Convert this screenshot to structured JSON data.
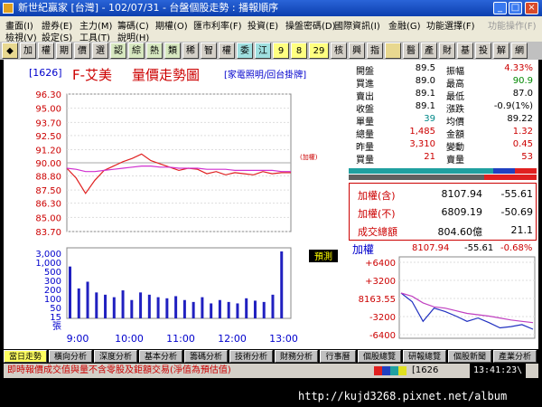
{
  "window": {
    "title": "新世紀贏家 [台灣] - 102/07/31 - 台盤個股走勢 : 播報順序",
    "minimize": "_",
    "maximize": "□",
    "close": "×"
  },
  "menu": {
    "row1": [
      "畫面(I)",
      "證券(E)",
      "主力(M)",
      "籌碼(C)",
      "期權(O)",
      "匯市利率(F)",
      "投資(E)",
      "操盤密碼(D)",
      "國際資訊(I)",
      "金融(G)",
      "功能選擇(F)",
      "功能操作(F)"
    ],
    "row2": [
      "檢視(V)",
      "設定(S)",
      "工具(T)",
      "說明(H)"
    ]
  },
  "toolbar": [
    "◆",
    "加",
    "權",
    "期",
    "價",
    "選",
    "認",
    "綜",
    "熱",
    "類",
    "稀",
    "智",
    "權",
    "委",
    "江",
    "9",
    "8",
    "29",
    "核",
    "興",
    "指",
    "",
    "醫",
    "產",
    "財",
    "基",
    "投",
    "解",
    "網"
  ],
  "stock": {
    "code": "[1626]",
    "name": "F-艾美",
    "chart_title": "量價走勢圖",
    "links": "[家電照明/回台掛牌]",
    "price_marker": "(加權)",
    "volume_button": "預測"
  },
  "quote": {
    "rows": [
      {
        "l1": "開盤",
        "v1": "89.5",
        "c1": "#000000",
        "l2": "振幅",
        "v2": "4.33%",
        "c2": "#cc0000"
      },
      {
        "l1": "買進",
        "v1": "89.0",
        "c1": "#000000",
        "l2": "最高",
        "v2": "90.9",
        "c2": "#008800"
      },
      {
        "l1": "賣出",
        "v1": "89.1",
        "c1": "#000000",
        "l2": "最低",
        "v2": "87.0",
        "c2": "#000000"
      },
      {
        "l1": "收盤",
        "v1": "89.1",
        "c1": "#000000",
        "l2": "漲跌",
        "v2": "-0.9(1%)",
        "c2": "#000000"
      },
      {
        "l1": "單量",
        "v1": "39",
        "c1": "#008888",
        "l2": "均價",
        "v2": "89.22",
        "c2": "#000000"
      },
      {
        "l1": "總量",
        "v1": "1,485",
        "c1": "#cc0000",
        "l2": "金額",
        "v2": "1.32",
        "c2": "#cc0000"
      },
      {
        "l1": "昨量",
        "v1": "3,310",
        "c1": "#cc0000",
        "l2": "變動",
        "v2": "0.45",
        "c2": "#cc0000"
      },
      {
        "l1": "買量",
        "v1": "21",
        "c1": "#cc0000",
        "l2": "賣量",
        "v2": "53",
        "c2": "#cc0000"
      }
    ]
  },
  "index": {
    "rows": [
      {
        "label": "加權(含)",
        "value": "8107.94",
        "change": "-55.61"
      },
      {
        "label": "加權(不)",
        "value": "6809.19",
        "change": "-50.69"
      },
      {
        "label": "成交總額",
        "value": "804.60億",
        "change": "21.1"
      }
    ],
    "mini_label": "加權",
    "mini_value": "8107.94",
    "mini_change": "-55.61",
    "mini_pct": "-0.68%",
    "mini_yticks": [
      "+6400",
      "+3200",
      "8163.55",
      "-3200",
      "-6400"
    ]
  },
  "tabs": [
    "當日走勢",
    "橫向分析",
    "深度分析",
    "基本分析",
    "籌碼分析",
    "技術分析",
    "財務分析",
    "行事曆",
    "個股總覽",
    "研報總覽",
    "個股新聞",
    "產業分析"
  ],
  "status": {
    "text": "即時報價成交值與量不含零股及鉅額交易(淨值為預估值)",
    "code": "[1626",
    "time": "13:41:23\\"
  },
  "watermark": "http://kujd3268.pixnet.net/album",
  "colors": {
    "price": "#e02020",
    "avg": "#d030d0",
    "volume": "#2020c0",
    "mini_index": "#2030c0",
    "mini_ref": "#c040c0"
  },
  "chart_data": [
    {
      "type": "line",
      "name": "price",
      "yticks": [
        "96.30",
        "95.00",
        "93.70",
        "92.50",
        "91.20",
        "90.00",
        "88.80",
        "87.50",
        "86.30",
        "85.00",
        "83.70"
      ],
      "ylim": [
        83.7,
        96.3
      ],
      "xticks": [
        "9:00",
        "10:00",
        "11:00",
        "12:00",
        "13:00"
      ],
      "x": [
        "9:00",
        "9:05",
        "9:10",
        "9:15",
        "9:20",
        "9:30",
        "9:40",
        "9:50",
        "10:00",
        "10:10",
        "10:20",
        "10:30",
        "10:40",
        "10:50",
        "11:00",
        "11:15",
        "11:30",
        "11:45",
        "12:00",
        "12:15",
        "12:30",
        "12:45",
        "13:00",
        "13:15",
        "13:30"
      ],
      "series": [
        {
          "values": [
            89.5,
            88.6,
            87.2,
            88.4,
            89.3,
            89.7,
            90.1,
            90.4,
            90.8,
            90.2,
            89.9,
            89.6,
            89.3,
            89.5,
            89.4,
            89.0,
            89.2,
            88.9,
            89.1,
            89.0,
            88.9,
            89.2,
            89.0,
            89.1,
            89.1
          ]
        },
        {
          "values": [
            89.5,
            89.4,
            89.2,
            89.2,
            89.3,
            89.4,
            89.5,
            89.6,
            89.7,
            89.7,
            89.6,
            89.6,
            89.5,
            89.5,
            89.5,
            89.4,
            89.4,
            89.4,
            89.3,
            89.3,
            89.3,
            89.3,
            89.3,
            89.2,
            89.2
          ]
        }
      ],
      "ref": 90.0
    },
    {
      "type": "bar",
      "name": "volume",
      "yticks": [
        "3,000",
        "1,000",
        "500",
        "300",
        "200",
        "100",
        "50",
        "15",
        "張"
      ],
      "values": [
        120,
        40,
        60,
        30,
        25,
        20,
        35,
        15,
        30,
        25,
        20,
        18,
        22,
        15,
        12,
        20,
        10,
        15,
        12,
        10,
        18,
        14,
        12,
        25,
        200
      ]
    },
    {
      "type": "line",
      "name": "index",
      "yticks": [
        "+6400",
        "+3200",
        "8163.55",
        "-3200",
        "-6400"
      ],
      "series": [
        {
          "values": [
            8163,
            8150,
            8120,
            8140,
            8135,
            8128,
            8120,
            8125,
            8118,
            8110,
            8112,
            8115,
            8108
          ]
        },
        {
          "values": [
            8163,
            8158,
            8148,
            8142,
            8140,
            8136,
            8132,
            8130,
            8128,
            8125,
            8122,
            8120,
            8118
          ]
        }
      ]
    }
  ]
}
